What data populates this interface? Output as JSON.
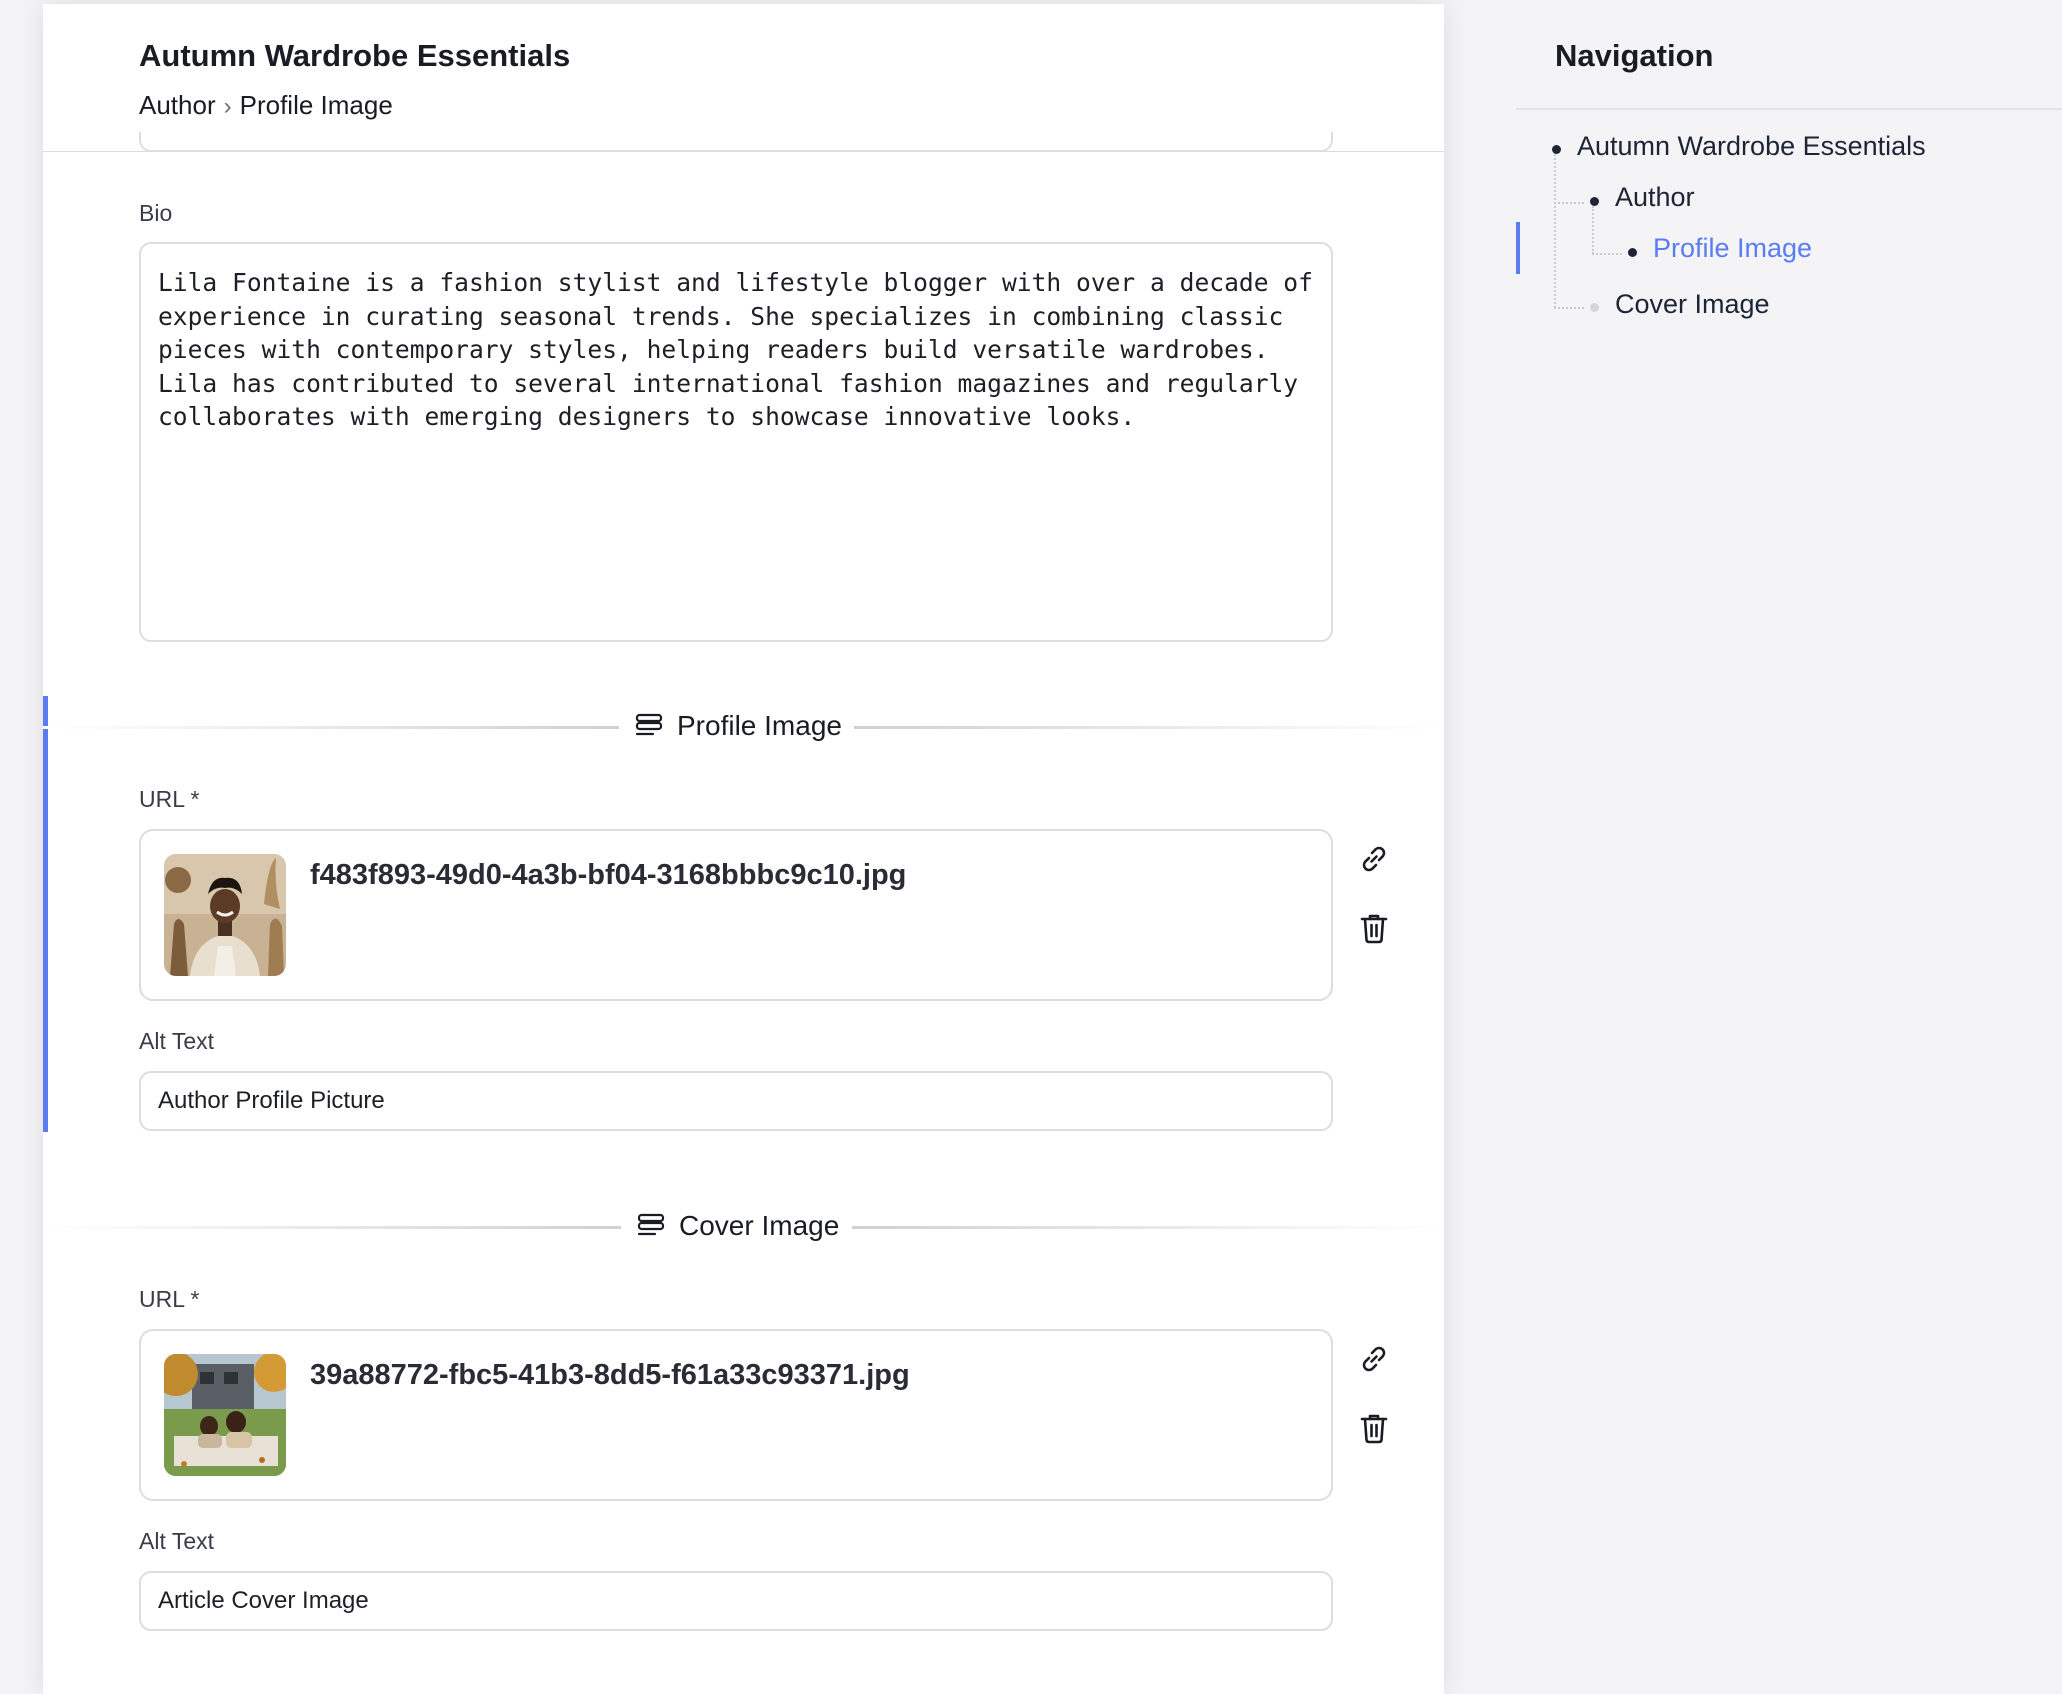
{
  "document": {
    "title": "Autumn Wardrobe Essentials",
    "breadcrumb": [
      "Author",
      "Profile Image"
    ],
    "breadcrumb_separator": "›"
  },
  "author": {
    "bio_label": "Bio",
    "bio_value": "Lila Fontaine is a fashion stylist and lifestyle blogger with over a decade of experience in curating seasonal trends. She specializes in combining classic pieces with contemporary styles, helping readers build versatile wardrobes. Lila has contributed to several international fashion magazines and regularly collaborates with emerging designers to showcase innovative looks."
  },
  "profile_image": {
    "section_title": "Profile Image",
    "section_icon": "stack-icon",
    "url_label": "URL *",
    "file_name": "f483f893-49d0-4a3b-bf04-3168bbbc9c10.jpg",
    "alt_label": "Alt Text",
    "alt_value": "Author Profile Picture",
    "actions": [
      "link-icon",
      "trash-icon"
    ]
  },
  "cover_image": {
    "section_title": "Cover Image",
    "section_icon": "stack-icon",
    "url_label": "URL *",
    "file_name": "39a88772-fbc5-41b3-8dd5-f61a33c93371.jpg",
    "alt_label": "Alt Text",
    "alt_value": "Article Cover Image",
    "actions": [
      "link-icon",
      "trash-icon"
    ]
  },
  "navigation": {
    "title": "Navigation",
    "items": [
      {
        "label": "Autumn Wardrobe Essentials",
        "level": 0,
        "active": false
      },
      {
        "label": "Author",
        "level": 1,
        "active": false
      },
      {
        "label": "Profile Image",
        "level": 2,
        "active": true
      },
      {
        "label": "Cover Image",
        "level": 1,
        "active": false
      }
    ]
  },
  "colors": {
    "accent": "#5b7cf0",
    "border": "#dcdde3",
    "text": "#1a1c24",
    "background": "#f4f4f6"
  }
}
